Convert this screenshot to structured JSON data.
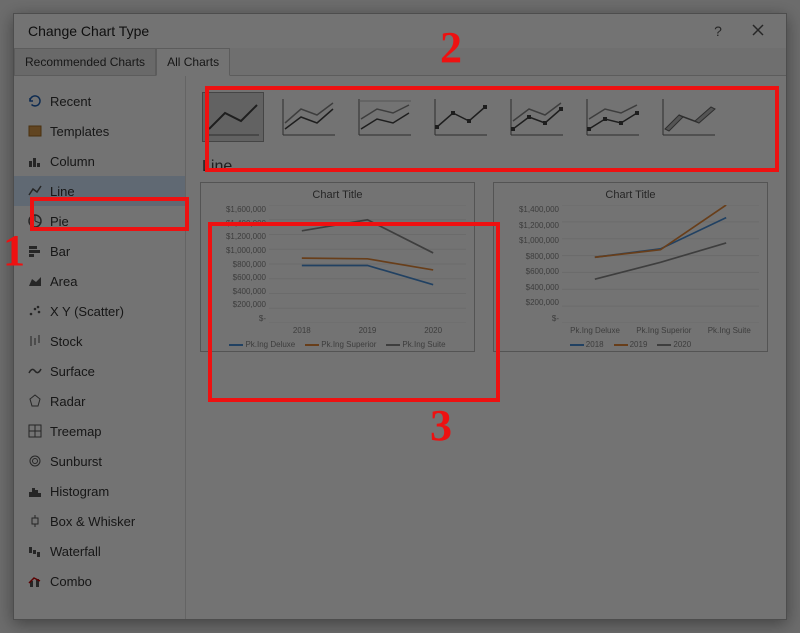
{
  "dialog": {
    "title": "Change Chart Type",
    "help_label": "?",
    "close_label": "✕"
  },
  "tabs": {
    "recommended": "Recommended Charts",
    "all": "All Charts"
  },
  "sidebar": {
    "items": [
      {
        "label": "Recent"
      },
      {
        "label": "Templates"
      },
      {
        "label": "Column"
      },
      {
        "label": "Line"
      },
      {
        "label": "Pie"
      },
      {
        "label": "Bar"
      },
      {
        "label": "Area"
      },
      {
        "label": "X Y (Scatter)"
      },
      {
        "label": "Stock"
      },
      {
        "label": "Surface"
      },
      {
        "label": "Radar"
      },
      {
        "label": "Treemap"
      },
      {
        "label": "Sunburst"
      },
      {
        "label": "Histogram"
      },
      {
        "label": "Box & Whisker"
      },
      {
        "label": "Waterfall"
      },
      {
        "label": "Combo"
      }
    ],
    "selected_index": 3
  },
  "main": {
    "section_title": "Line",
    "subtypes_count": 7,
    "selected_subtype": 0
  },
  "previews": [
    {
      "title": "Chart Title",
      "y_ticks": [
        "$1,600,000",
        "$1,400,000",
        "$1,200,000",
        "$1,000,000",
        "$800,000",
        "$600,000",
        "$400,000",
        "$200,000",
        "$-"
      ],
      "x_ticks": [
        "2018",
        "2019",
        "2020"
      ],
      "legend": [
        "Pk.Ing Deluxe",
        "Pk.Ing Superior",
        "Pk.Ing Suite"
      ],
      "colors": [
        "#4a90d9",
        "#e78b3a",
        "#8a8a8a"
      ]
    },
    {
      "title": "Chart Title",
      "y_ticks": [
        "$1,400,000",
        "$1,200,000",
        "$1,000,000",
        "$800,000",
        "$600,000",
        "$400,000",
        "$200,000",
        "$-"
      ],
      "x_ticks": [
        "Pk.Ing Deluxe",
        "Pk.Ing Superior",
        "Pk.Ing Suite"
      ],
      "legend": [
        "2018",
        "2019",
        "2020"
      ],
      "colors": [
        "#4a90d9",
        "#e78b3a",
        "#8a8a8a"
      ]
    }
  ],
  "callouts": {
    "n1": "1",
    "n2": "2",
    "n3": "3"
  },
  "chart_data": [
    {
      "type": "line",
      "title": "Chart Title",
      "categories": [
        "2018",
        "2019",
        "2020"
      ],
      "ylim": [
        0,
        1600000
      ],
      "series": [
        {
          "name": "Pk.Ing Deluxe",
          "values": [
            780000,
            780000,
            520000
          ],
          "color": "#4a90d9"
        },
        {
          "name": "Pk.Ing Superior",
          "values": [
            880000,
            870000,
            720000
          ],
          "color": "#e78b3a"
        },
        {
          "name": "Pk.Ing Suite",
          "values": [
            1250000,
            1400000,
            950000
          ],
          "color": "#8a8a8a"
        }
      ]
    },
    {
      "type": "line",
      "title": "Chart Title",
      "categories": [
        "Pk.Ing Deluxe",
        "Pk.Ing Superior",
        "Pk.Ing Suite"
      ],
      "ylim": [
        0,
        1400000
      ],
      "series": [
        {
          "name": "2018",
          "values": [
            780000,
            880000,
            1250000
          ],
          "color": "#4a90d9"
        },
        {
          "name": "2019",
          "values": [
            780000,
            870000,
            1400000
          ],
          "color": "#e78b3a"
        },
        {
          "name": "2020",
          "values": [
            520000,
            720000,
            950000
          ],
          "color": "#8a8a8a"
        }
      ]
    }
  ]
}
